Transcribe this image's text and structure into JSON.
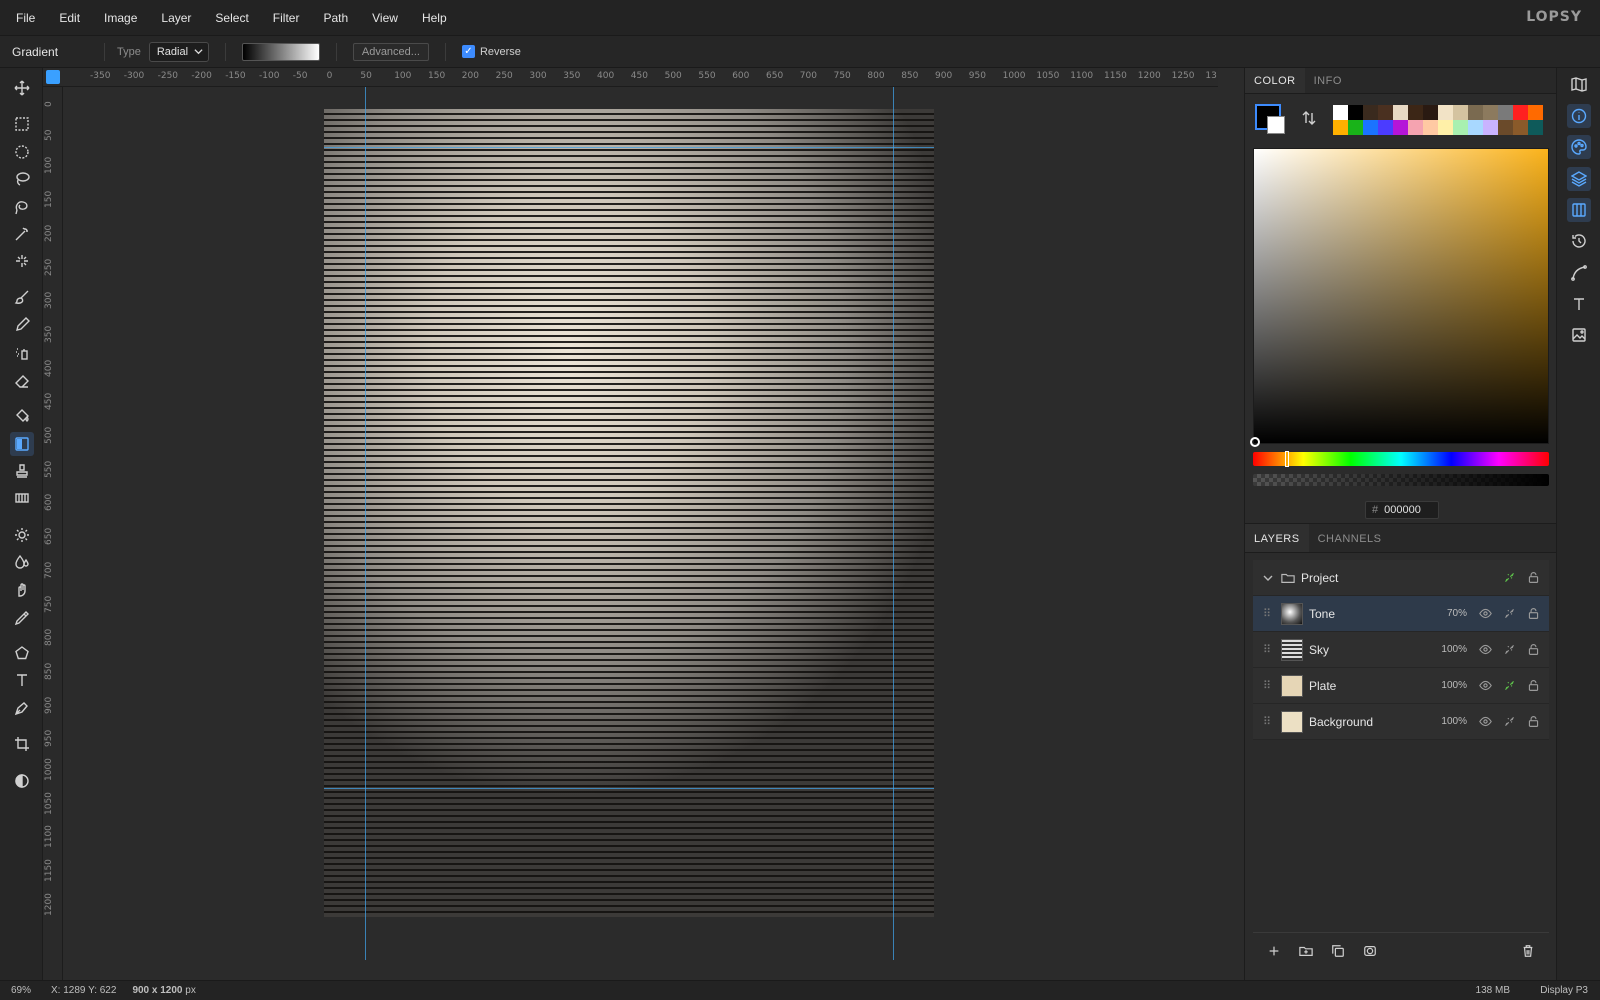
{
  "app": {
    "logo": "LOPSY"
  },
  "menu": [
    "File",
    "Edit",
    "Image",
    "Layer",
    "Select",
    "Filter",
    "Path",
    "View",
    "Help"
  ],
  "options": {
    "tool_name": "Gradient",
    "type_label": "Type",
    "type_value": "Radial",
    "advanced_label": "Advanced...",
    "reverse_label": "Reverse",
    "reverse_checked": true
  },
  "tools": [
    "move-icon",
    "rect-select-icon",
    "ellipse-select-icon",
    "lasso-icon",
    "magnetic-lasso-icon",
    "magic-wand-icon",
    "quick-select-icon",
    "brush-icon",
    "pencil-icon",
    "spray-icon",
    "eraser-icon",
    "bucket-icon",
    "gradient-icon",
    "stamp-icon",
    "pattern-icon",
    "dodge-icon",
    "blur-icon",
    "smudge-icon",
    "eyedropper-icon",
    "shape-icon",
    "text-icon",
    "pen-icon",
    "crop-icon",
    "contrast-icon"
  ],
  "rulers": {
    "h_labels": [
      "-350",
      "-300",
      "-250",
      "-200",
      "-150",
      "-100",
      "-50",
      "0",
      "50",
      "100",
      "150",
      "200",
      "250",
      "300",
      "350",
      "400",
      "450",
      "500",
      "550",
      "600",
      "650",
      "700",
      "750",
      "800",
      "850",
      "900",
      "950",
      "1000",
      "1050",
      "1100",
      "1150",
      "1200",
      "1250",
      "13"
    ],
    "v_labels": [
      "0",
      "50",
      "100",
      "150",
      "200",
      "250",
      "300",
      "350",
      "400",
      "450",
      "500",
      "550",
      "600",
      "650",
      "700",
      "750",
      "800",
      "850",
      "900",
      "950",
      "1000",
      "1050",
      "1100",
      "1150",
      "1200"
    ]
  },
  "color_panel": {
    "tabs": [
      "COLOR",
      "INFO"
    ],
    "foreground": "#000000",
    "background": "#ffffff",
    "hex_hash": "#",
    "hex_value": "000000",
    "palette": [
      "#ffffff",
      "#000000",
      "#3a2a1e",
      "#4a3020",
      "#e8d9c4",
      "#3c2616",
      "#2a1a12",
      "#f2e3c6",
      "#d4c3a0",
      "#7a6a50",
      "#8c7a5e",
      "#7a7a7a",
      "#ff2020",
      "#ff6a00",
      "#ffb000",
      "#19b319",
      "#1a73ff",
      "#4b3cff",
      "#b515d8",
      "#f5a3b0",
      "#ffc9a3",
      "#fff0a8",
      "#a8f0b0",
      "#a8d8ff",
      "#c9b3ff",
      "#6a4a2a",
      "#8a5a2a",
      "#0e5a5a"
    ]
  },
  "layers_panel": {
    "tabs": [
      "LAYERS",
      "CHANNELS"
    ],
    "group": {
      "name": "Project"
    },
    "layers": [
      {
        "name": "Tone",
        "opacity": "70%",
        "selected": true
      },
      {
        "name": "Sky",
        "opacity": "100%",
        "selected": false
      },
      {
        "name": "Plate",
        "opacity": "100%",
        "selected": false
      },
      {
        "name": "Background",
        "opacity": "100%",
        "selected": false
      }
    ]
  },
  "status": {
    "zoom": "69%",
    "coords": "X: 1289 Y: 622",
    "size_value": "900 x 1200",
    "size_unit": "px",
    "memory": "138 MB",
    "display": "Display P3"
  }
}
